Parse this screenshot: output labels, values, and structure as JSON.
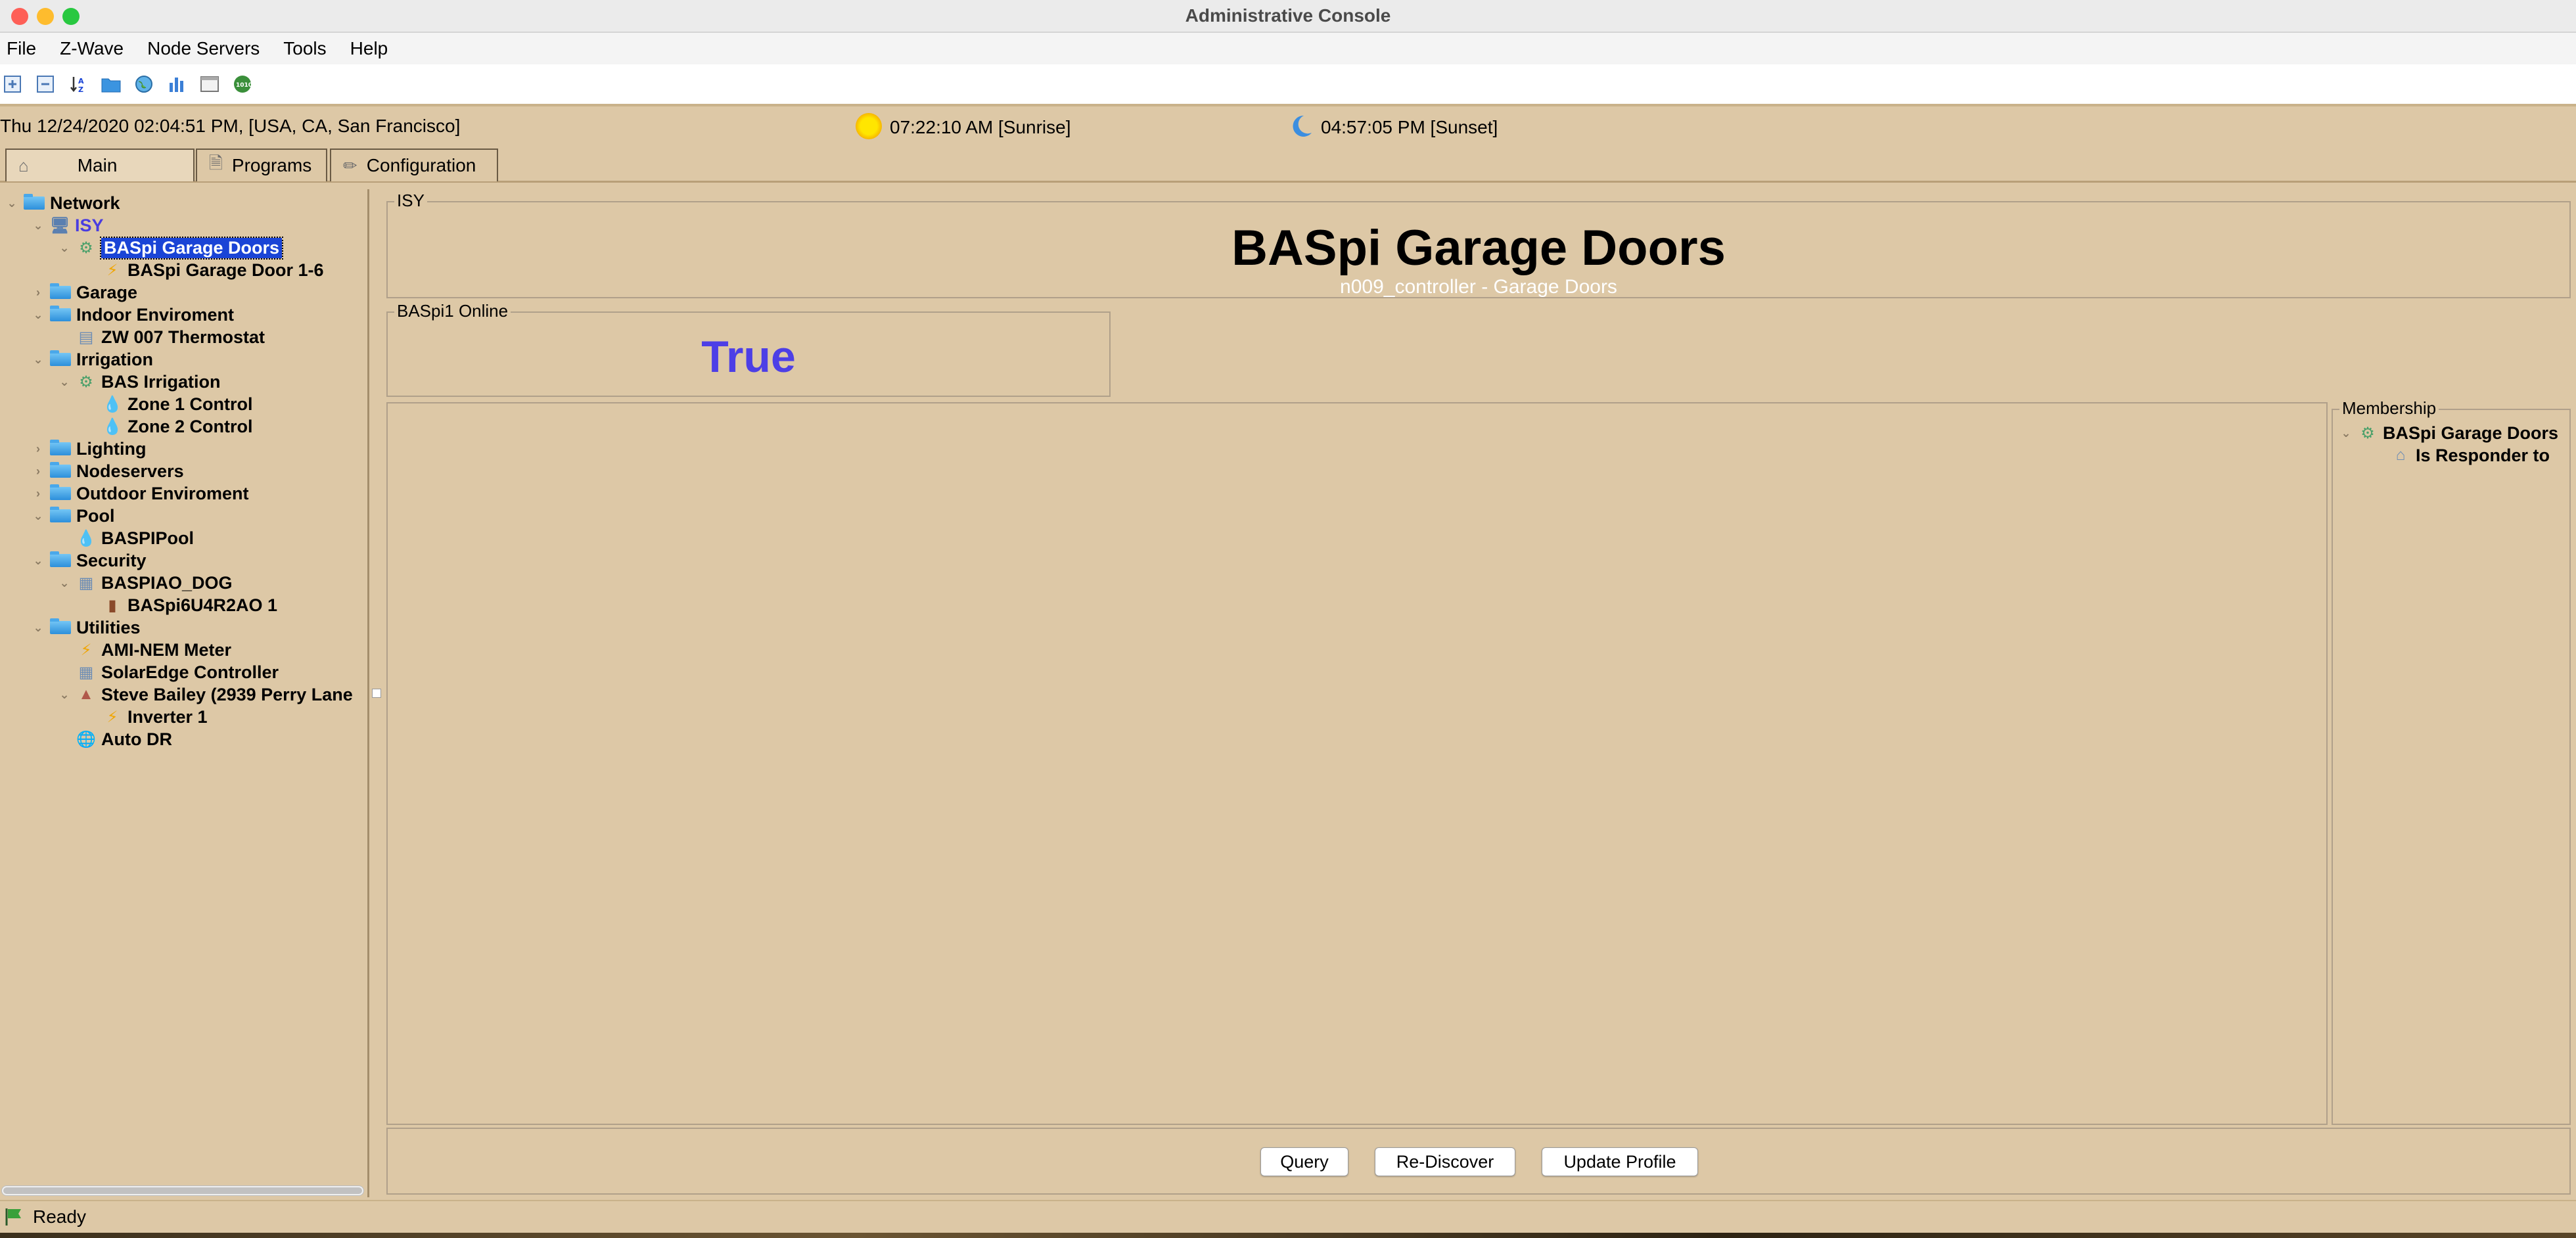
{
  "window": {
    "title": "Administrative Console"
  },
  "menu": [
    "File",
    "Z-Wave",
    "Node Servers",
    "Tools",
    "Help"
  ],
  "toolbar_icons": [
    "expand-all-icon",
    "collapse-all-icon",
    "sort-icon",
    "folder-icon",
    "globe-icon",
    "chart-icon",
    "window-icon",
    "device-icon"
  ],
  "info": {
    "datetime": "Thu 12/24/2020 02:04:51 PM,  [USA, CA, San Francisco]",
    "sunrise": "07:22:10 AM [Sunrise]",
    "sunset": "04:57:05 PM [Sunset]"
  },
  "tabs": {
    "main": "Main",
    "programs": "Programs",
    "configuration": "Configuration"
  },
  "tree": {
    "network": "Network",
    "isy": "ISY",
    "baspi_garage_doors": "BASpi Garage Doors",
    "baspi_garage_door_1_6": "BASpi Garage Door 1-6",
    "garage": "Garage",
    "indoor": "Indoor Enviroment",
    "zw007": "ZW 007 Thermostat",
    "irrigation": "Irrigation",
    "bas_irrigation": "BAS Irrigation",
    "zone1": "Zone 1 Control",
    "zone2": "Zone 2 Control",
    "lighting": "Lighting",
    "nodeservers": "Nodeservers",
    "outdoor": "Outdoor Enviroment",
    "pool": "Pool",
    "baspipool": "BASPIPool",
    "security": "Security",
    "baspiao_dog": "BASPIAO_DOG",
    "baspi6u4r2ao": "BASpi6U4R2AO 1",
    "utilities": "Utilities",
    "ami_nem": "AMI-NEM Meter",
    "solaredge": "SolarEdge Controller",
    "steve_bailey": "Steve Bailey (2939 Perry Lane",
    "inverter1": "Inverter 1",
    "auto_dr": "Auto DR"
  },
  "node": {
    "group_label": "ISY",
    "title": "BASpi Garage Doors",
    "subtitle": "n009_controller - Garage Doors"
  },
  "status": {
    "label": "BASpi1 Online",
    "value": "True"
  },
  "membership": {
    "label": "Membership",
    "item": "BASpi Garage Doors",
    "sub_item": "Is Responder to"
  },
  "buttons": {
    "query": "Query",
    "rediscover": "Re-Discover",
    "update_profile": "Update Profile"
  },
  "statusbar": {
    "text": "Ready"
  },
  "colors": {
    "selection": "#1a44d6",
    "status_value": "#4d3fe6",
    "background": "#ddc8a6"
  }
}
